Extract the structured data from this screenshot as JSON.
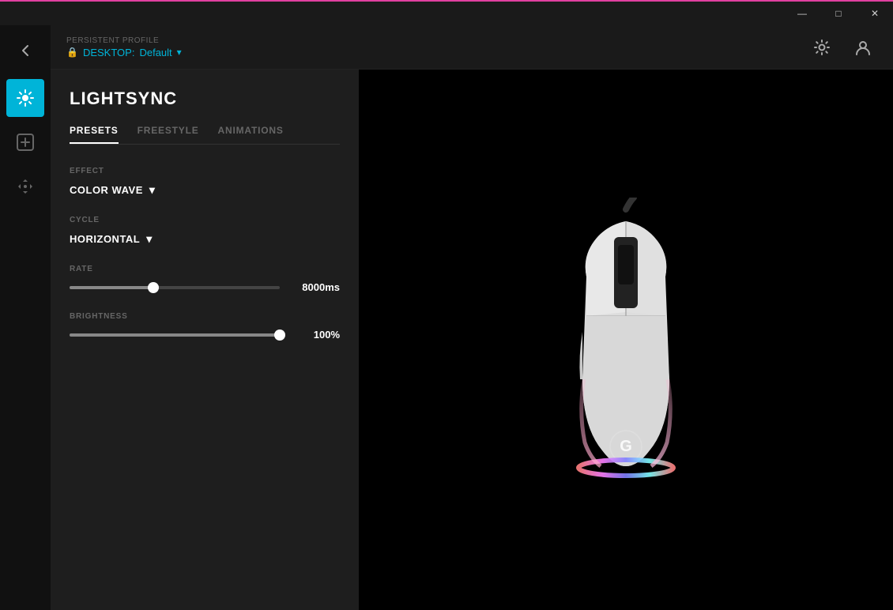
{
  "titlebar": {
    "title": "",
    "minimize": "—",
    "maximize": "□",
    "close": "✕"
  },
  "header": {
    "persistent_profile_label": "PERSISTENT PROFILE",
    "profile_prefix": "DESKTOP:",
    "profile_name": "Default",
    "settings_icon": "⚙",
    "user_icon": "👤"
  },
  "sidebar": {
    "back_icon": "←",
    "lightsync_icon": "✦",
    "add_icon": "+",
    "move_icon": "✥"
  },
  "panel": {
    "title": "LIGHTSYNC",
    "tabs": [
      {
        "label": "PRESETS",
        "active": true
      },
      {
        "label": "FREESTYLE",
        "active": false
      },
      {
        "label": "ANIMATIONS",
        "active": false
      }
    ],
    "effect_label": "EFFECT",
    "effect_value": "COLOR WAVE",
    "cycle_label": "CYCLE",
    "cycle_value": "HORIZONTAL",
    "rate_label": "RATE",
    "rate_value": "8000ms",
    "rate_percent": 40,
    "brightness_label": "BRIGHTNESS",
    "brightness_value": "100%",
    "brightness_percent": 100
  }
}
